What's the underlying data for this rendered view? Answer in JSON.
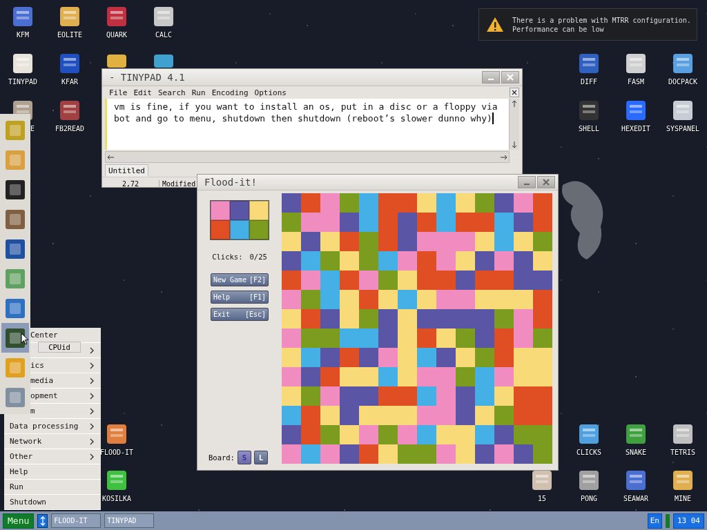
{
  "notification": {
    "lines": [
      "There is a problem with MTRR configuration.",
      "Performance can be low"
    ]
  },
  "desktop": {
    "top_left": [
      {
        "label": "KFM"
      },
      {
        "label": "EOLITE"
      },
      {
        "label": "QUARK"
      },
      {
        "label": "CALC"
      },
      {
        "label": "TINYPAD"
      },
      {
        "label": "KFAR"
      },
      {
        "label": "E"
      },
      {
        "label": "FB2READ"
      }
    ],
    "top_right": [
      {
        "label": "DIFF"
      },
      {
        "label": "FASM"
      },
      {
        "label": "DOCPACK"
      },
      {
        "label": "SHELL"
      },
      {
        "label": "HEXEDIT"
      },
      {
        "label": "SYSPANEL"
      }
    ],
    "bottom_left": [
      {
        "label": "FLOOD-IT"
      },
      {
        "label": "KOSILKA"
      }
    ],
    "bottom_right": [
      {
        "label": "CLICKS"
      },
      {
        "label": "SNAKE"
      },
      {
        "label": "TETRIS"
      },
      {
        "label": "15"
      },
      {
        "label": "PONG"
      },
      {
        "label": "SEAWAR"
      },
      {
        "label": "MINE"
      }
    ]
  },
  "tinypad": {
    "title": "- TINYPAD 4.1",
    "menu": [
      "File",
      "Edit",
      "Search",
      "Run",
      "Encoding",
      "Options"
    ],
    "lines": [
      "vm is fine, if you want to install an os, put in a disc or a floppy via",
      "bot and go to menu, shutdown then shutdown (reboot’s slower dunno why)"
    ],
    "tabs": [
      {
        "label": "Untitled",
        "selected": true
      }
    ],
    "status": [
      "2,72",
      "Modified"
    ]
  },
  "flood_it": {
    "title": "Flood-it!",
    "palette": [
      {
        "color": "#f08cc0"
      },
      {
        "color": "#5b55a5"
      },
      {
        "color": "#f8da78"
      },
      {
        "color": "#e04e24"
      },
      {
        "color": "#44b0e6"
      },
      {
        "color": "#7c9c20"
      }
    ],
    "clicks_label": "Clicks:",
    "clicks": "0/25",
    "buttons": [
      {
        "label": "New Game",
        "key": "[F2]"
      },
      {
        "label": "Help",
        "key": "[F1]"
      },
      {
        "label": "Exit",
        "key": "[Esc]"
      }
    ],
    "board_label": "Board:",
    "board_sizes": [
      {
        "label": "S",
        "selected": true
      },
      {
        "label": "L",
        "selected": false
      }
    ]
  },
  "sidebar": {
    "items": [
      {
        "selected": false
      },
      {
        "selected": false
      },
      {
        "selected": false
      },
      {
        "selected": false
      },
      {
        "selected": false
      },
      {
        "selected": false
      },
      {
        "selected": false
      },
      {
        "selected": true
      },
      {
        "selected": false
      },
      {
        "selected": false
      }
    ]
  },
  "tooltip": "CPUid",
  "menu": {
    "covered_items": [
      {
        "label": "Center",
        "submenu": false
      },
      {
        "submenu": true
      },
      {
        "label": "ics",
        "submenu": true
      },
      {
        "label": "media",
        "submenu": true
      },
      {
        "label": "opment",
        "submenu": true
      },
      {
        "label": "m",
        "submenu": true
      }
    ],
    "items": [
      {
        "label": "Data processing",
        "submenu": true
      },
      {
        "label": "Network",
        "submenu": true
      },
      {
        "label": "Other",
        "submenu": true
      },
      {
        "label": "Help",
        "submenu": false
      },
      {
        "label": "Run",
        "submenu": false
      },
      {
        "label": "Shutdown",
        "submenu": false
      }
    ]
  },
  "taskbar": {
    "menu_button": "Menu",
    "tasks": [
      "FLOOD-IT",
      "TINYPAD"
    ],
    "language": "En",
    "clock": "13 04"
  }
}
